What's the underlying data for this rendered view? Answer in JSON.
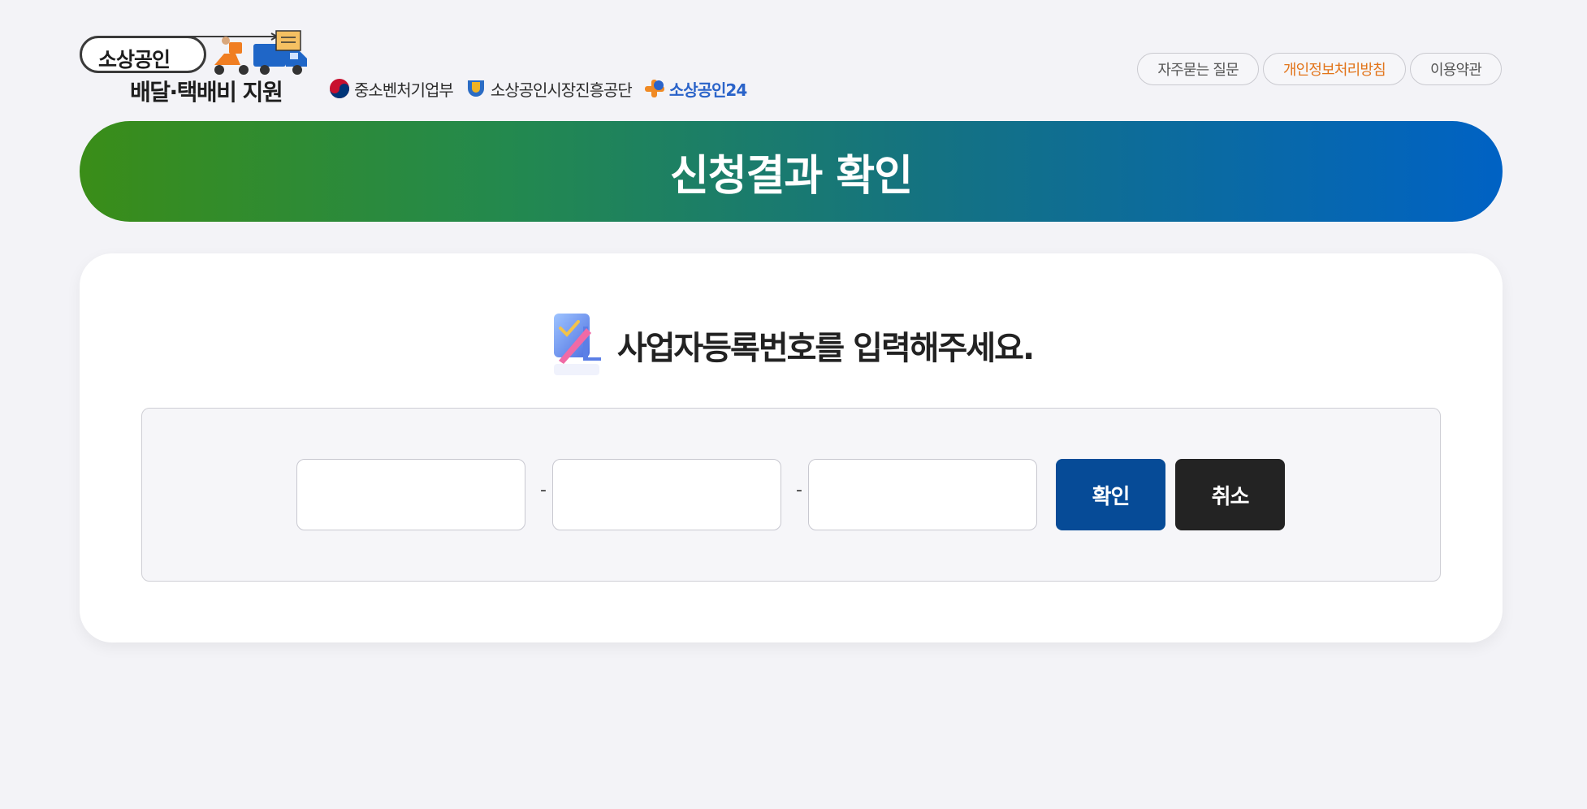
{
  "header": {
    "logo_top_text": "소상공인",
    "logo_bottom_text": "배달·택배비 지원",
    "agencies": [
      {
        "label": "중소벤처기업부",
        "icon": "korea-taegeuk-icon"
      },
      {
        "label": "소상공인시장진흥공단",
        "icon": "semas-emblem-icon"
      },
      {
        "label": "소상공인24",
        "icon": "sbiz24-logo-icon"
      }
    ],
    "links": [
      {
        "label": "자주묻는 질문"
      },
      {
        "label": "개인정보처리방침"
      },
      {
        "label": "이용약관"
      }
    ]
  },
  "banner": {
    "title": "신청결과 확인"
  },
  "form": {
    "prompt_icon": "form-check-pen-icon",
    "prompt": "사업자등록번호를 입력해주세요.",
    "fields": [
      {
        "value": "",
        "placeholder": ""
      },
      {
        "value": "",
        "placeholder": ""
      },
      {
        "value": "",
        "placeholder": ""
      }
    ],
    "separator": "-",
    "confirm_label": "확인",
    "cancel_label": "취소"
  },
  "colors": {
    "background": "#f3f3f7",
    "banner_start": "#3a8d18",
    "banner_end": "#0062c4",
    "confirm_button": "#064b97",
    "cancel_button": "#232323",
    "privacy_link": "#e2741a"
  }
}
